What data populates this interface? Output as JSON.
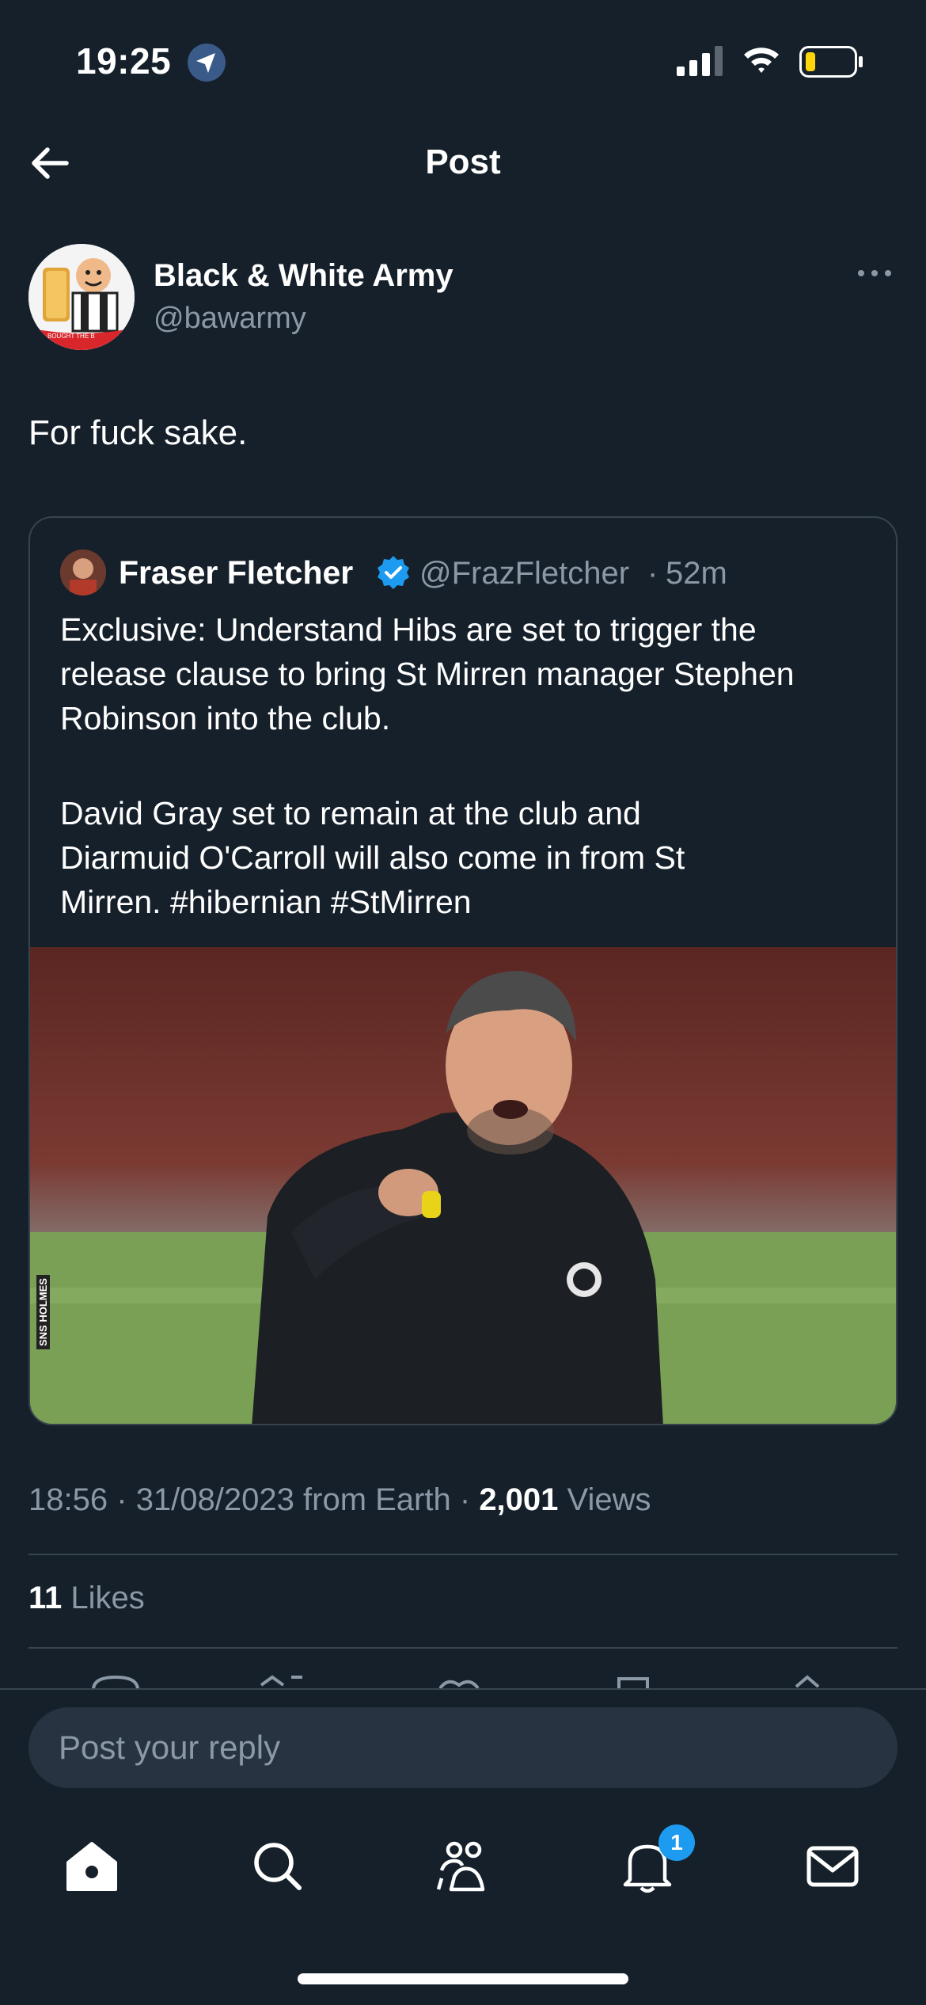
{
  "status_bar": {
    "time": "19:25"
  },
  "header": {
    "title": "Post"
  },
  "author": {
    "name": "Black & White Army",
    "handle": "@bawarmy",
    "avatar_text": "BOUGHT THE B"
  },
  "tweet": {
    "text": "For fuck sake."
  },
  "quote": {
    "name": "Fraser Fletcher",
    "handle": "@FrazFletcher",
    "separator": "·",
    "time": "52m",
    "lines": [
      "Exclusive: Understand Hibs are set to trigger the",
      "release clause to bring St Mirren manager Stephen",
      "Robinson into the club.",
      "",
      "David Gray set to remain at the club and",
      "Diarmuid O'Carroll will also come in from St",
      "Mirren. #hibernian #StMirren"
    ],
    "photo_credit": "SNS HOLMES"
  },
  "meta": {
    "time": "18:56",
    "date": "31/08/2023",
    "source": "from Earth",
    "views_count": "2,001",
    "views_label": "Views",
    "likes_count": "11",
    "likes_label": "Likes"
  },
  "reply": {
    "placeholder": "Post your reply"
  },
  "nav": {
    "notifications_badge": "1"
  },
  "colors": {
    "background": "#15202b",
    "accent": "#1d9bf0",
    "muted": "#8b98a5",
    "border": "#38444d"
  }
}
